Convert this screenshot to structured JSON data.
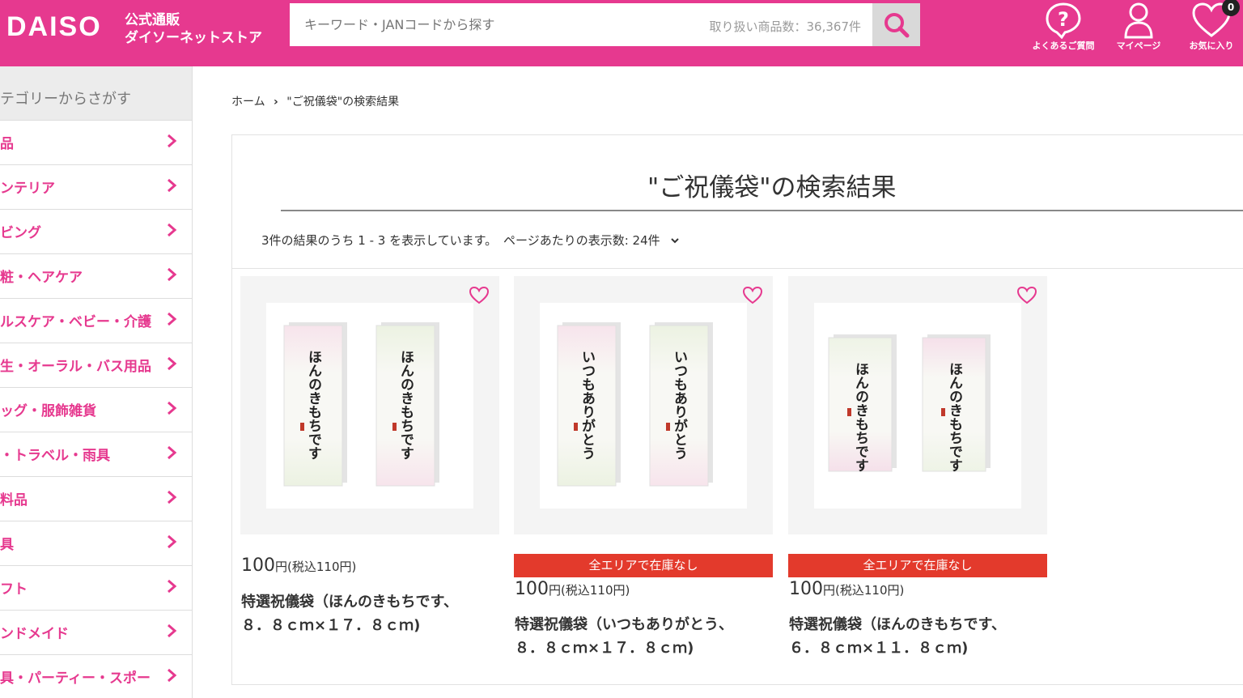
{
  "header": {
    "logo": "DAISO",
    "logo_sub1": "公式通販",
    "logo_sub2": "ダイソーネットストア",
    "search_placeholder": "キーワード・JANコードから探す",
    "item_count": "取り扱い商品数：36,367件",
    "faq_label": "よくあるご質問",
    "mypage_label": "マイページ",
    "favorites_label": "お気に入り",
    "favorites_count": "0"
  },
  "sidebar": {
    "title": "テゴリーからさがす",
    "items": [
      {
        "label": "品"
      },
      {
        "label": "ンテリア"
      },
      {
        "label": "ビング"
      },
      {
        "label": "粧・ヘアケア"
      },
      {
        "label": "ルスケア・ベビー・介護"
      },
      {
        "label": "生・オーラル・バス用品"
      },
      {
        "label": "ッグ・服飾雑貨"
      },
      {
        "label": "・トラベル・雨具"
      },
      {
        "label": "料品"
      },
      {
        "label": "具"
      },
      {
        "label": "フト"
      },
      {
        "label": "ンドメイド"
      },
      {
        "label": "具・パーティー・スポー"
      }
    ]
  },
  "breadcrumb": {
    "home": "ホーム",
    "separator": "›",
    "current": "\"ご祝儀袋\"の検索結果"
  },
  "results": {
    "title": "\"ご祝儀袋\"の検索結果",
    "info": "3件の結果のうち 1 - 3 を表示しています。",
    "per_page": "ページあたりの表示数: 24件"
  },
  "products": [
    {
      "price": "100",
      "yen": "円",
      "tax": "(税込110円)",
      "stock": "",
      "name_line1": "特選祝儀袋（ほんのきもちです、",
      "name_line2": "８．８ｃｍ×１７．８ｃｍ)",
      "calligraphy": "ほんのきもちです",
      "style": "pink-green"
    },
    {
      "price": "100",
      "yen": "円",
      "tax": "(税込110円)",
      "stock": "全エリアで在庫なし",
      "name_line1": "特選祝儀袋（いつもありがとう、",
      "name_line2": "８．８ｃｍ×１７．８ｃｍ)",
      "calligraphy": "いつもありがとう",
      "style": "pink-green"
    },
    {
      "price": "100",
      "yen": "円",
      "tax": "(税込110円)",
      "stock": "全エリアで在庫なし",
      "name_line1": "特選祝儀袋（ほんのきもちです、",
      "name_line2": "６．８ｃｍ×１１．８ｃｍ)",
      "calligraphy": "ほんのきもちです",
      "style": "green-pink"
    }
  ],
  "colors": {
    "brand": "#e6398f",
    "stock_out": "#e33a2c"
  }
}
